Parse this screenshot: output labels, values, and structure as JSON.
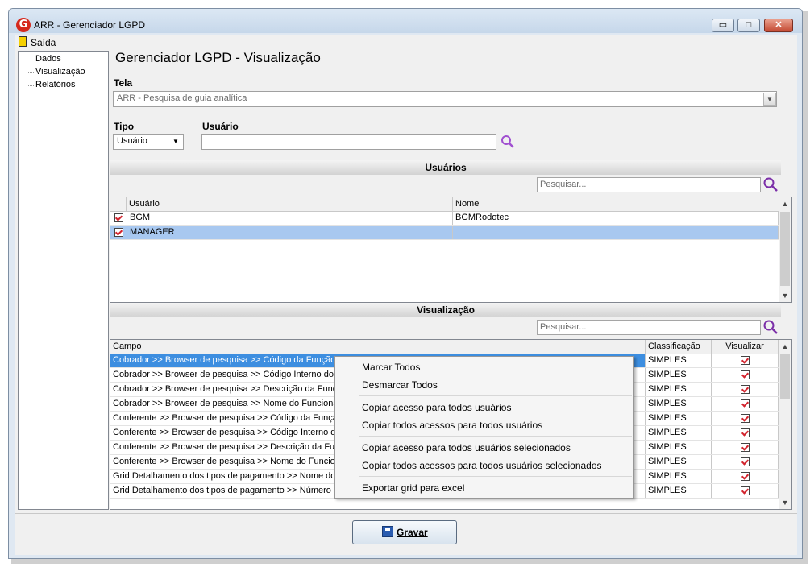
{
  "window": {
    "title": "ARR - Gerenciador LGPD",
    "logo_letter": "G",
    "controls": {
      "minimize": "▭",
      "maximize": "□",
      "close": "✕"
    }
  },
  "menu": {
    "exit_label": "Saída"
  },
  "tree": {
    "items": [
      "Dados",
      "Visualização",
      "Relatórios"
    ]
  },
  "page": {
    "title": "Gerenciador LGPD - Visualização",
    "tela_label": "Tela",
    "tela_value": "ARR - Pesquisa de guia analítica",
    "tipo_label": "Tipo",
    "tipo_value": "Usuário",
    "usuario_label": "Usuário",
    "usuario_value": ""
  },
  "usuarios": {
    "section_title": "Usuários",
    "search_placeholder": "Pesquisar...",
    "columns": [
      "Usuário",
      "Nome"
    ],
    "rows": [
      {
        "checked": true,
        "usuario": "BGM",
        "nome": "BGMRodotec"
      },
      {
        "checked": true,
        "usuario": "MANAGER",
        "nome": ""
      }
    ]
  },
  "visualizacao": {
    "section_title": "Visualização",
    "search_placeholder": "Pesquisar...",
    "columns": [
      "Campo",
      "Classificação",
      "Visualizar"
    ],
    "rows": [
      {
        "campo": "Cobrador >> Browser de pesquisa >> Código da Função do",
        "classificacao": "SIMPLES",
        "visualizar": true
      },
      {
        "campo": "Cobrador >> Browser de pesquisa >> Código Interno do Fu",
        "classificacao": "SIMPLES",
        "visualizar": true
      },
      {
        "campo": "Cobrador >> Browser de pesquisa >> Descrição da Função",
        "classificacao": "SIMPLES",
        "visualizar": true
      },
      {
        "campo": "Cobrador >> Browser de pesquisa >> Nome do Funcionário",
        "classificacao": "SIMPLES",
        "visualizar": true
      },
      {
        "campo": "Conferente >> Browser de pesquisa >> Código da Função",
        "classificacao": "SIMPLES",
        "visualizar": true
      },
      {
        "campo": "Conferente >> Browser de pesquisa >> Código Interno do F",
        "classificacao": "SIMPLES",
        "visualizar": true
      },
      {
        "campo": "Conferente >> Browser de pesquisa >> Descrição da Funç",
        "classificacao": "SIMPLES",
        "visualizar": true
      },
      {
        "campo": "Conferente >> Browser de pesquisa >> Nome do Funcioná",
        "classificacao": "SIMPLES",
        "visualizar": true
      },
      {
        "campo": "Grid Detalhamento dos tipos de pagamento >> Nome do P",
        "classificacao": "SIMPLES",
        "visualizar": true
      },
      {
        "campo": "Grid Detalhamento dos tipos de pagamento >> Número do",
        "classificacao": "SIMPLES",
        "visualizar": true
      }
    ]
  },
  "context_menu": {
    "items": [
      "Marcar Todos",
      "Desmarcar Todos",
      "Copiar acesso para todos usuários",
      "Copiar todos acessos para todos usuários",
      "Copiar acesso para todos usuários selecionados",
      "Copiar todos acessos para todos usuários selecionados",
      "Exportar grid para excel"
    ]
  },
  "footer": {
    "save_label": "Gravar"
  },
  "colors": {
    "selection": "#3d8ee0",
    "check": "#d3242e",
    "search_icon": "#7b2fa8"
  }
}
